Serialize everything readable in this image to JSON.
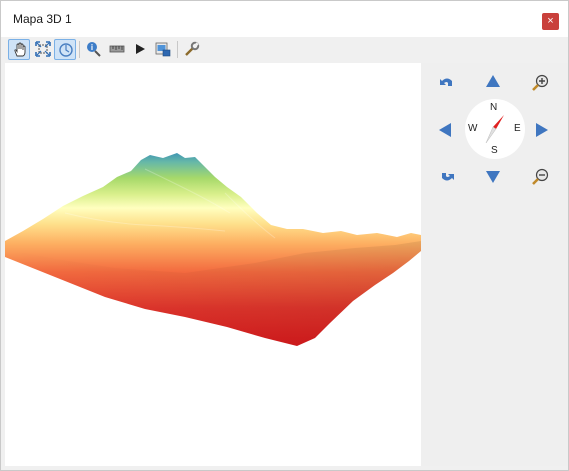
{
  "window": {
    "title": "Mapa 3D 1",
    "close_glyph": "×",
    "colors": {
      "close": "#c9403b",
      "toolbar_active": "#cfe3f7",
      "nav_arrow": "#3f76c0"
    }
  },
  "toolbar": {
    "items": [
      {
        "icon": "pan-hand-icon",
        "active": true
      },
      {
        "icon": "zoom-full-icon",
        "active": false
      },
      {
        "icon": "camera-control-icon",
        "active": true
      },
      {
        "icon": "identify-icon",
        "active": false
      },
      {
        "icon": "measure-line-icon",
        "active": false
      },
      {
        "icon": "play-animation-icon",
        "active": false
      },
      {
        "icon": "export-map-icon",
        "active": false
      },
      {
        "icon": "configure-icon",
        "active": false
      }
    ]
  },
  "navigation": {
    "compass": {
      "north": "N",
      "south": "S",
      "east": "E",
      "west": "W"
    },
    "controls": [
      "rotate-left-icon",
      "move-up-icon",
      "zoom-in-icon",
      "move-left-icon",
      "move-right-icon",
      "rotate-right-icon",
      "move-down-icon",
      "zoom-out-icon"
    ]
  },
  "terrain": {
    "colormap": [
      "#d7191c",
      "#f36a3f",
      "#fdae61",
      "#fee08b",
      "#ffffbf",
      "#d9ef8b",
      "#a6d96a",
      "#2b83ba"
    ]
  }
}
